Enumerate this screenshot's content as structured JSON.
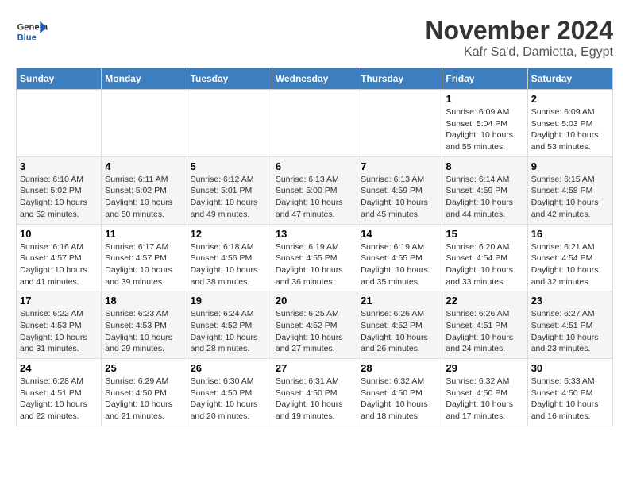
{
  "logo": {
    "text_general": "General",
    "text_blue": "Blue"
  },
  "title": "November 2024",
  "subtitle": "Kafr Sa'd, Damietta, Egypt",
  "days_of_week": [
    "Sunday",
    "Monday",
    "Tuesday",
    "Wednesday",
    "Thursday",
    "Friday",
    "Saturday"
  ],
  "weeks": [
    [
      {
        "day": "",
        "info": ""
      },
      {
        "day": "",
        "info": ""
      },
      {
        "day": "",
        "info": ""
      },
      {
        "day": "",
        "info": ""
      },
      {
        "day": "",
        "info": ""
      },
      {
        "day": "1",
        "info": "Sunrise: 6:09 AM\nSunset: 5:04 PM\nDaylight: 10 hours and 55 minutes."
      },
      {
        "day": "2",
        "info": "Sunrise: 6:09 AM\nSunset: 5:03 PM\nDaylight: 10 hours and 53 minutes."
      }
    ],
    [
      {
        "day": "3",
        "info": "Sunrise: 6:10 AM\nSunset: 5:02 PM\nDaylight: 10 hours and 52 minutes."
      },
      {
        "day": "4",
        "info": "Sunrise: 6:11 AM\nSunset: 5:02 PM\nDaylight: 10 hours and 50 minutes."
      },
      {
        "day": "5",
        "info": "Sunrise: 6:12 AM\nSunset: 5:01 PM\nDaylight: 10 hours and 49 minutes."
      },
      {
        "day": "6",
        "info": "Sunrise: 6:13 AM\nSunset: 5:00 PM\nDaylight: 10 hours and 47 minutes."
      },
      {
        "day": "7",
        "info": "Sunrise: 6:13 AM\nSunset: 4:59 PM\nDaylight: 10 hours and 45 minutes."
      },
      {
        "day": "8",
        "info": "Sunrise: 6:14 AM\nSunset: 4:59 PM\nDaylight: 10 hours and 44 minutes."
      },
      {
        "day": "9",
        "info": "Sunrise: 6:15 AM\nSunset: 4:58 PM\nDaylight: 10 hours and 42 minutes."
      }
    ],
    [
      {
        "day": "10",
        "info": "Sunrise: 6:16 AM\nSunset: 4:57 PM\nDaylight: 10 hours and 41 minutes."
      },
      {
        "day": "11",
        "info": "Sunrise: 6:17 AM\nSunset: 4:57 PM\nDaylight: 10 hours and 39 minutes."
      },
      {
        "day": "12",
        "info": "Sunrise: 6:18 AM\nSunset: 4:56 PM\nDaylight: 10 hours and 38 minutes."
      },
      {
        "day": "13",
        "info": "Sunrise: 6:19 AM\nSunset: 4:55 PM\nDaylight: 10 hours and 36 minutes."
      },
      {
        "day": "14",
        "info": "Sunrise: 6:19 AM\nSunset: 4:55 PM\nDaylight: 10 hours and 35 minutes."
      },
      {
        "day": "15",
        "info": "Sunrise: 6:20 AM\nSunset: 4:54 PM\nDaylight: 10 hours and 33 minutes."
      },
      {
        "day": "16",
        "info": "Sunrise: 6:21 AM\nSunset: 4:54 PM\nDaylight: 10 hours and 32 minutes."
      }
    ],
    [
      {
        "day": "17",
        "info": "Sunrise: 6:22 AM\nSunset: 4:53 PM\nDaylight: 10 hours and 31 minutes."
      },
      {
        "day": "18",
        "info": "Sunrise: 6:23 AM\nSunset: 4:53 PM\nDaylight: 10 hours and 29 minutes."
      },
      {
        "day": "19",
        "info": "Sunrise: 6:24 AM\nSunset: 4:52 PM\nDaylight: 10 hours and 28 minutes."
      },
      {
        "day": "20",
        "info": "Sunrise: 6:25 AM\nSunset: 4:52 PM\nDaylight: 10 hours and 27 minutes."
      },
      {
        "day": "21",
        "info": "Sunrise: 6:26 AM\nSunset: 4:52 PM\nDaylight: 10 hours and 26 minutes."
      },
      {
        "day": "22",
        "info": "Sunrise: 6:26 AM\nSunset: 4:51 PM\nDaylight: 10 hours and 24 minutes."
      },
      {
        "day": "23",
        "info": "Sunrise: 6:27 AM\nSunset: 4:51 PM\nDaylight: 10 hours and 23 minutes."
      }
    ],
    [
      {
        "day": "24",
        "info": "Sunrise: 6:28 AM\nSunset: 4:51 PM\nDaylight: 10 hours and 22 minutes."
      },
      {
        "day": "25",
        "info": "Sunrise: 6:29 AM\nSunset: 4:50 PM\nDaylight: 10 hours and 21 minutes."
      },
      {
        "day": "26",
        "info": "Sunrise: 6:30 AM\nSunset: 4:50 PM\nDaylight: 10 hours and 20 minutes."
      },
      {
        "day": "27",
        "info": "Sunrise: 6:31 AM\nSunset: 4:50 PM\nDaylight: 10 hours and 19 minutes."
      },
      {
        "day": "28",
        "info": "Sunrise: 6:32 AM\nSunset: 4:50 PM\nDaylight: 10 hours and 18 minutes."
      },
      {
        "day": "29",
        "info": "Sunrise: 6:32 AM\nSunset: 4:50 PM\nDaylight: 10 hours and 17 minutes."
      },
      {
        "day": "30",
        "info": "Sunrise: 6:33 AM\nSunset: 4:50 PM\nDaylight: 10 hours and 16 minutes."
      }
    ]
  ]
}
